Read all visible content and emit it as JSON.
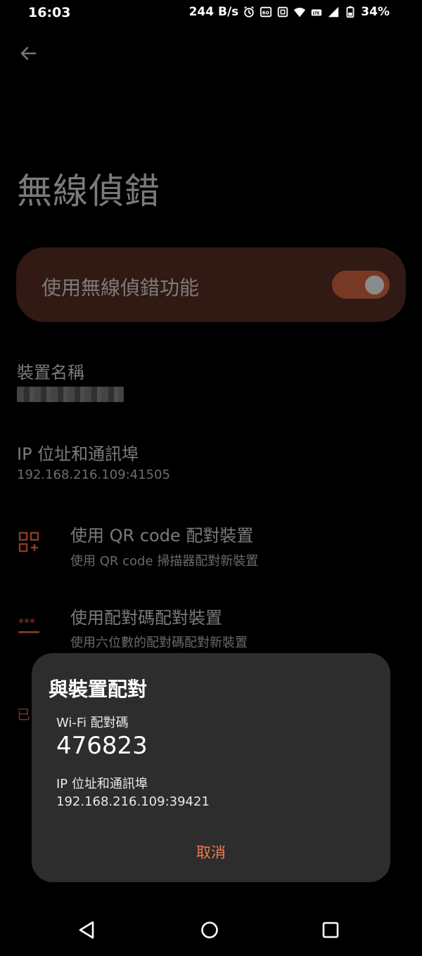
{
  "status_bar": {
    "time": "16:03",
    "net_speed": "244 B/s",
    "battery": "34%",
    "icons": [
      "alarm-icon",
      "hd-icon",
      "nfc-icon",
      "wifi-icon",
      "volte-icon",
      "signal-icon",
      "battery-icon"
    ]
  },
  "header": {
    "title": "無線偵錯",
    "back_icon": "arrow-back-icon"
  },
  "main_switch": {
    "label": "使用無線偵錯功能",
    "checked": true
  },
  "device_name": {
    "title": "裝置名稱"
  },
  "ip_port": {
    "title": "IP 位址和通訊埠",
    "value": "192.168.216.109:41505"
  },
  "pair_qr": {
    "title": "使用 QR code 配對裝置",
    "summary": "使用 QR code 掃描器配對新裝置",
    "icon": "qr-code-icon"
  },
  "pair_code": {
    "title": "使用配對碼配對裝置",
    "summary": "使用六位數的配對碼配對新裝置",
    "icon": "password-icon"
  },
  "paired_peek": "已",
  "dialog": {
    "title": "與裝置配對",
    "wifi_label": "Wi-Fi 配對碼",
    "pair_code": "476823",
    "ip_label": "IP 位址和通訊埠",
    "ip_value": "192.168.216.109:39421",
    "cancel_label": "取消"
  },
  "colors": {
    "accent": "#f17b51",
    "switch_track": "#783924",
    "dialog_bg": "#2d2d2d",
    "card_bg": "#301a13"
  }
}
